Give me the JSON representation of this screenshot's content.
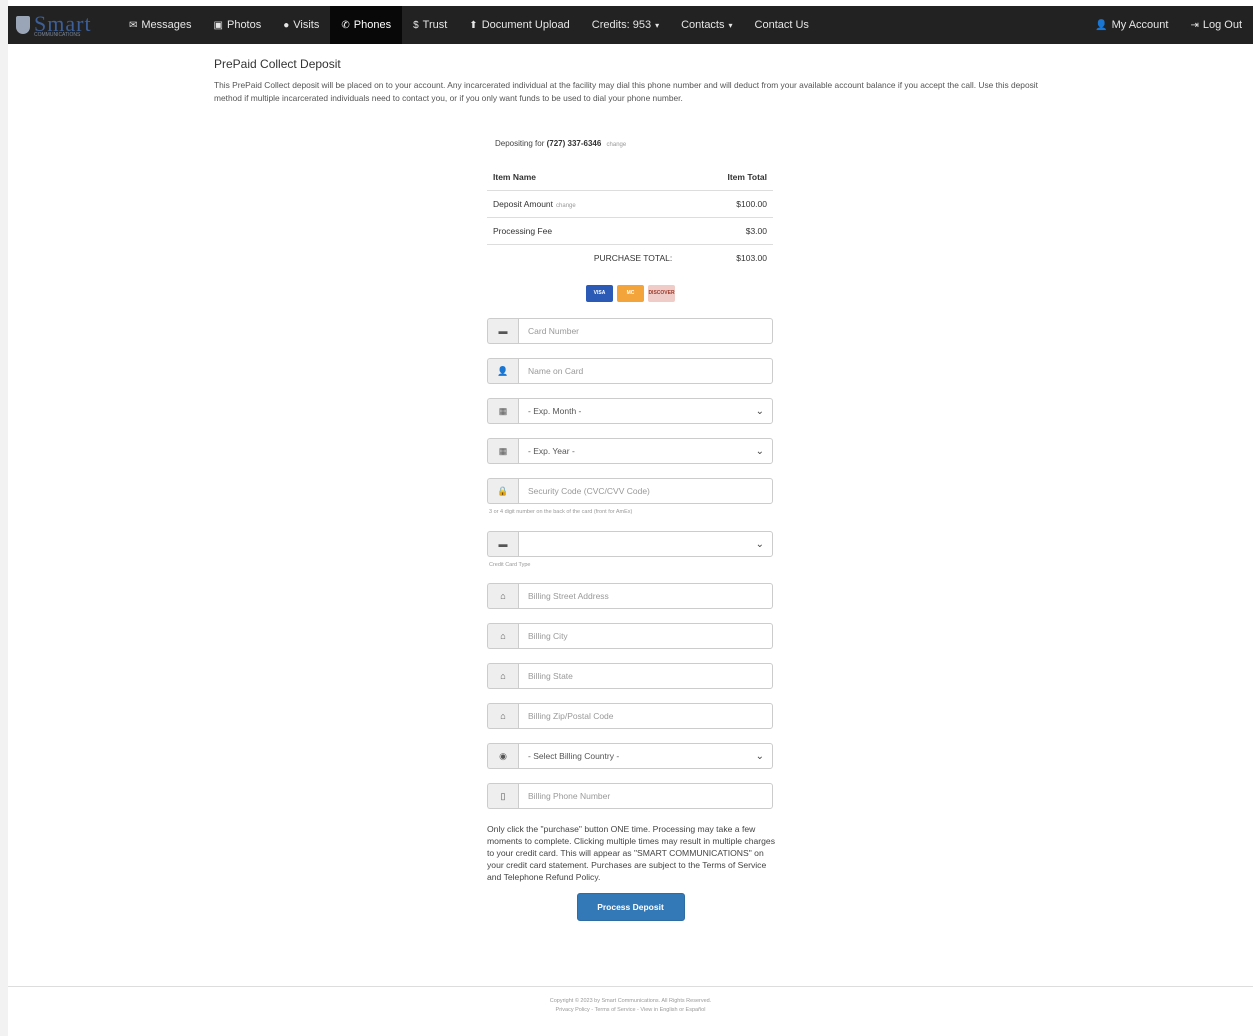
{
  "nav": {
    "logo_text": "Smart",
    "logo_sub": "COMMUNICATIONS",
    "items": [
      {
        "label": "Messages",
        "icon": "envelope-icon",
        "glyph": "✉"
      },
      {
        "label": "Photos",
        "icon": "picture-icon",
        "glyph": "▣"
      },
      {
        "label": "Visits",
        "icon": "video-icon",
        "glyph": "●"
      },
      {
        "label": "Phones",
        "icon": "phone-icon",
        "glyph": "✆"
      },
      {
        "label": "Trust",
        "icon": "dollar-icon",
        "glyph": "$"
      },
      {
        "label": "Document Upload",
        "icon": "upload-icon",
        "glyph": "⬆"
      },
      {
        "label": "Credits: 953"
      },
      {
        "label": "Contacts"
      },
      {
        "label": "Contact Us"
      }
    ],
    "account": "My Account",
    "logout": "Log Out",
    "active": "Phones"
  },
  "page": {
    "title": "PrePaid Collect Deposit",
    "intro": "This PrePaid Collect deposit will be placed on to your account. Any incarcerated individual at the facility may dial this phone number and will deduct from your available account balance if you accept the call. Use this deposit method if multiple incarcerated individuals need to contact you, or if you only want funds to be used to dial your phone number.",
    "depositing_for_label": "Depositing for",
    "phone": "(727) 337-6346",
    "change_link": "change"
  },
  "summary": {
    "col_item": "Item Name",
    "col_total": "Item Total",
    "rows": [
      {
        "name": "Deposit Amount",
        "change": "change",
        "total": "$100.00"
      },
      {
        "name": "Processing Fee",
        "total": "$3.00"
      }
    ],
    "total_label": "PURCHASE TOTAL:",
    "total_value": "$103.00"
  },
  "cards": {
    "visa": "VISA",
    "mc": "MC",
    "discover": "DISCOVER"
  },
  "form": {
    "card_number": "Card Number",
    "name_on_card": "Name on Card",
    "exp_month": "- Exp. Month -",
    "exp_year": "- Exp. Year -",
    "security_code": "Security Code (CVC/CVV Code)",
    "security_help": "3 or 4 digit number on the back of the card (front for AmEx)",
    "card_type": "",
    "card_type_help": "Credit Card Type",
    "street": "Billing Street Address",
    "city": "Billing City",
    "state": "Billing State",
    "zip": "Billing Zip/Postal Code",
    "country": "- Select Billing Country -",
    "phone": "Billing Phone Number"
  },
  "notice": "Only click the \"purchase\" button ONE time. Processing may take a few moments to complete. Clicking multiple times may result in multiple charges to your credit card. This will appear as \"SMART COMMUNICATIONS\" on your credit card statement. Purchases are subject to the Terms of Service and Telephone Refund Policy.",
  "button": "Process Deposit",
  "footer": {
    "copyright": "Copyright © 2023 by Smart Communications. All Rights Reserved.",
    "links": "Privacy Policy - Terms of Service - View in English or Español"
  }
}
